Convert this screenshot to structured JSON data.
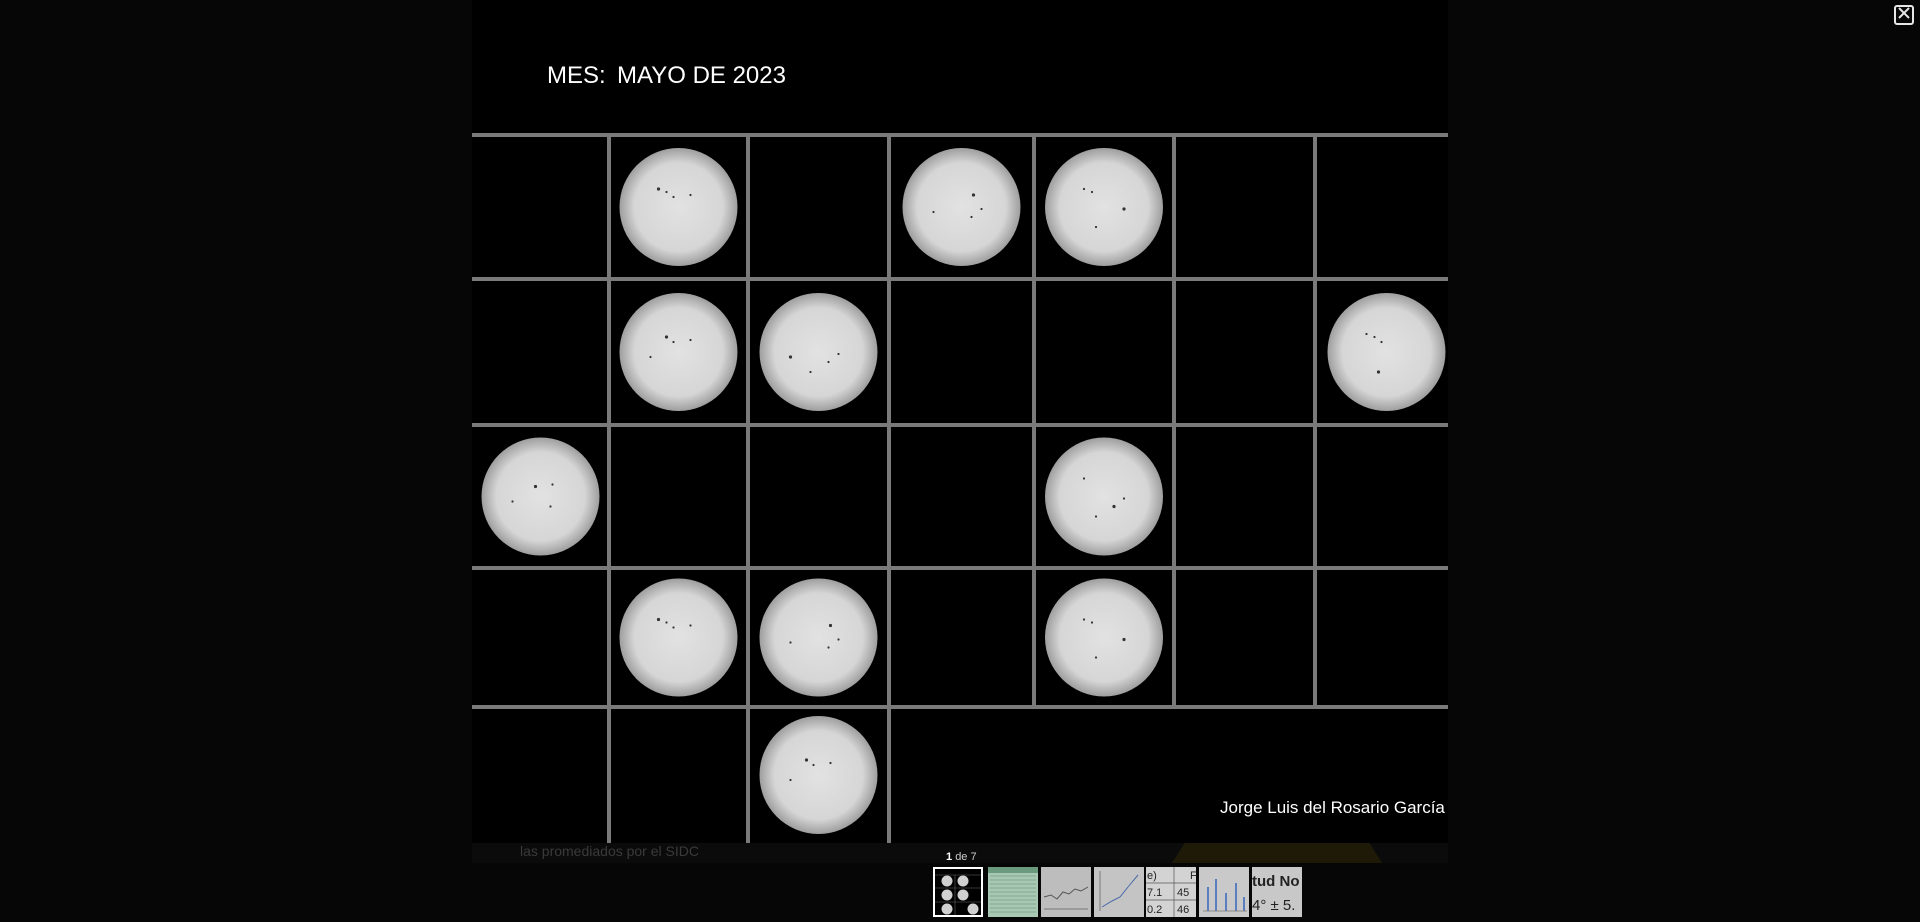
{
  "viewer": {
    "close_icon": "close-icon",
    "counter": {
      "current": "1",
      "separator": "de",
      "total": "7"
    }
  },
  "image": {
    "month_prefix": "MES:",
    "month_value": "MAYO DE 2023",
    "credit": "Jorge Luis del Rosario García",
    "grid": {
      "rows": 5,
      "cols": 7
    },
    "sun_cells": [
      [
        0,
        1
      ],
      [
        0,
        3
      ],
      [
        0,
        4
      ],
      [
        1,
        1
      ],
      [
        1,
        2
      ],
      [
        1,
        6
      ],
      [
        2,
        0
      ],
      [
        2,
        4
      ],
      [
        3,
        1
      ],
      [
        3,
        2
      ],
      [
        3,
        4
      ],
      [
        4,
        2
      ]
    ],
    "colors": {
      "background": "#000000",
      "grid_lines": "#7a7a7a",
      "sun_disk": "#d6d6d6"
    }
  },
  "behind_text": "las promediados por el SIDC",
  "thumbnails": [
    {
      "name": "thumb-1",
      "kind": "sun-grid",
      "active": true
    },
    {
      "name": "thumb-2",
      "kind": "green-table",
      "active": false
    },
    {
      "name": "thumb-3",
      "kind": "gray-chart",
      "active": false
    },
    {
      "name": "thumb-4",
      "kind": "line-chart",
      "active": false
    },
    {
      "name": "thumb-5",
      "kind": "data-table",
      "text": [
        "e)",
        "F",
        "7.1",
        "45",
        "0.2",
        "46"
      ],
      "active": false
    },
    {
      "name": "thumb-6",
      "kind": "bar-chart",
      "active": false
    },
    {
      "name": "thumb-7",
      "kind": "text-slide",
      "text": [
        "tud No",
        "4° ± 5."
      ],
      "active": false
    }
  ]
}
